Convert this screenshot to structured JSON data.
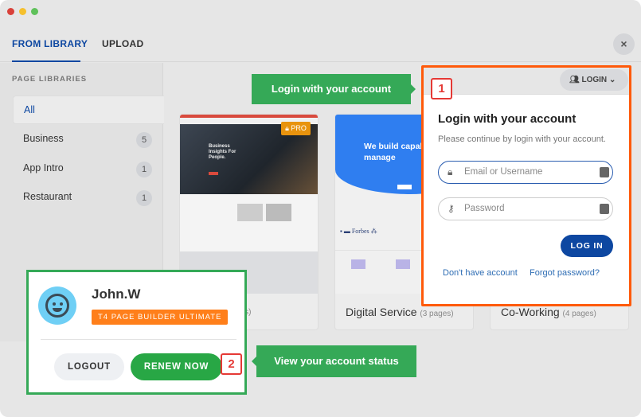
{
  "window": {
    "controls": {
      "close_color": "#d9413a",
      "min_color": "#f5c02d",
      "max_color": "#5fc15a"
    }
  },
  "tabs": [
    {
      "label": "FROM LIBRARY",
      "active": true
    },
    {
      "label": "UPLOAD",
      "active": false
    }
  ],
  "close_label": "×",
  "sidebar": {
    "title": "PAGE LIBRARIES",
    "items": [
      {
        "label": "All",
        "count": null,
        "active": true
      },
      {
        "label": "Business",
        "count": "5"
      },
      {
        "label": "App Intro",
        "count": "1"
      },
      {
        "label": "Restaurant",
        "count": "1"
      }
    ]
  },
  "cards": [
    {
      "title_fragment": "ges)",
      "badge": "PRO",
      "preview_headline": "Business Insights For People."
    },
    {
      "title": "Digital Service",
      "pages": "(3 pages)",
      "preview_headline": "We build capab energy manage"
    },
    {
      "title": "Co-Working",
      "pages": "(4 pages)"
    }
  ],
  "login_button": {
    "label": "LOGIN"
  },
  "tooltip1": {
    "text": "Login with your account",
    "number": "1"
  },
  "login_panel": {
    "title": "Login with your account",
    "subtitle": "Please continue by login with your account.",
    "email_placeholder": "Email or Username",
    "password_placeholder": "Password",
    "submit": "LOG IN",
    "no_account": "Don't have account",
    "forgot": "Forgot password?"
  },
  "user_panel": {
    "name": "John.W",
    "plan": "T4 PAGE BUILDER ULTIMATE",
    "logout": "LOGOUT",
    "renew": "RENEW NOW"
  },
  "tooltip2": {
    "text": "View your account status",
    "number": "2"
  },
  "colors": {
    "accent": "#0d47a1",
    "orange": "#ff5a0a",
    "green": "#35a957",
    "renew": "#28a745",
    "plan": "#ff7f1a"
  }
}
